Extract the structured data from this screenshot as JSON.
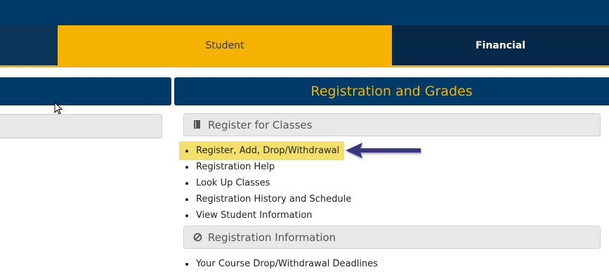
{
  "tabs": {
    "student": "Student",
    "financial": "Financial"
  },
  "panel": {
    "title": "Registration and Grades"
  },
  "sections": [
    {
      "title": "Register for Classes",
      "icon": "book-icon",
      "links": [
        "Register, Add, Drop/Withdrawal",
        "Registration Help",
        "Look Up Classes",
        "Registration History and Schedule",
        "View Student Information"
      ]
    },
    {
      "title": "Registration Information",
      "icon": "circle-slash-icon",
      "links": [
        "Your Course Drop/Withdrawal Deadlines"
      ]
    }
  ],
  "colors": {
    "navy": "#003a69",
    "gold": "#f5b300",
    "highlight": "#f3e06a",
    "arrow": "#3b3480"
  }
}
